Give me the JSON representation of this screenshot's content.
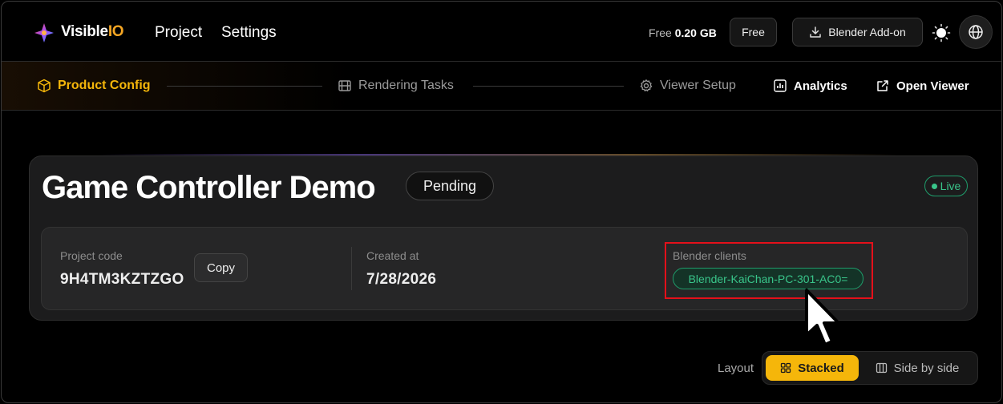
{
  "app": {
    "logo_text_main": "Visible",
    "logo_text_accent": "IO",
    "nav": [
      "Project",
      "Settings"
    ],
    "storage_label": "Free",
    "storage_value": "0.20 GB",
    "plan_button": "Free",
    "addon_button": "Blender Add-on"
  },
  "steps": [
    {
      "label": "Product Config",
      "icon": "cube-icon",
      "active": true
    },
    {
      "label": "Rendering Tasks",
      "icon": "film-icon",
      "active": false
    },
    {
      "label": "Viewer Setup",
      "icon": "gear-icon",
      "active": false
    },
    {
      "label": "Analytics",
      "icon": "bar-chart-icon",
      "active": false
    },
    {
      "label": "Open Viewer",
      "icon": "external-link-icon",
      "active": false
    }
  ],
  "project": {
    "title": "Game Controller Demo",
    "status": "Pending",
    "live_label": "Live",
    "code_label": "Project code",
    "code_value": "9H4TM3KZTZGO",
    "copy_button": "Copy",
    "created_label": "Created at",
    "created_value": "7/28/2026",
    "clients_label": "Blender clients",
    "client_value": "Blender-KaiChan-PC-301-AC0="
  },
  "layout_toggle": {
    "label": "Layout",
    "options": [
      "Stacked",
      "Side by side"
    ],
    "selected": "Stacked"
  },
  "colors": {
    "accent": "#f5b60a",
    "live_green": "#39c58a",
    "highlight_red": "#e4101a"
  }
}
